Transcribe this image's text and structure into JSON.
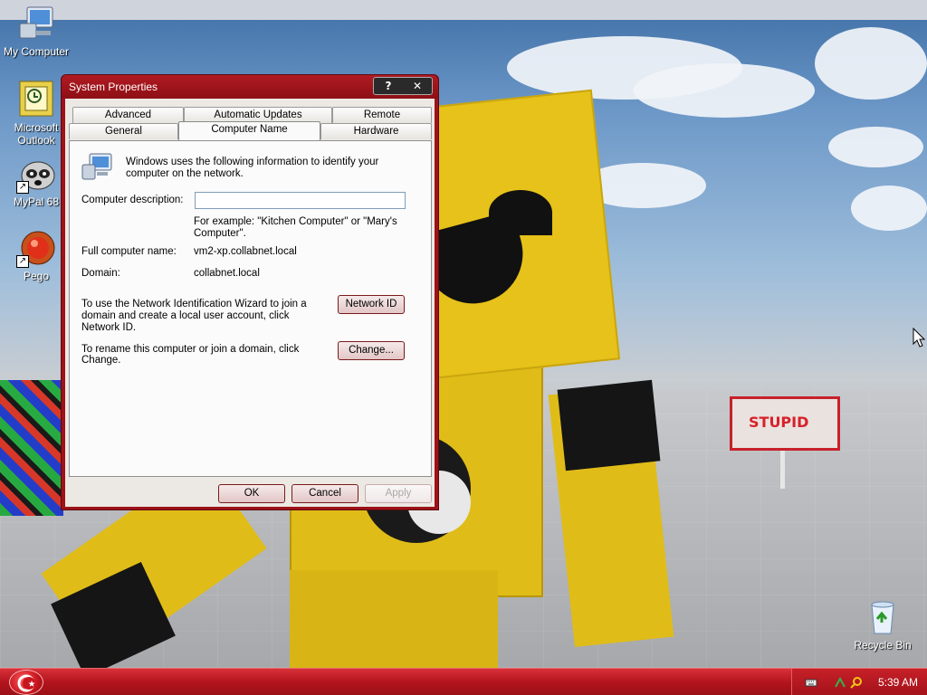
{
  "desktop": {
    "icons": [
      {
        "label": "My Computer"
      },
      {
        "label": "Microsoft Outlook"
      },
      {
        "label": "MyPal 68"
      },
      {
        "label": "Pego"
      },
      {
        "label": "Recycle Bin"
      }
    ],
    "sign_text": "STUPID"
  },
  "dialog": {
    "title": "System Properties",
    "help_button": "?",
    "close_button": "✕",
    "tabs_back": [
      "Advanced",
      "Automatic Updates",
      "Remote"
    ],
    "tabs_front": [
      "General",
      "Computer Name",
      "Hardware"
    ],
    "active_tab": "Computer Name",
    "intro": "Windows uses the following information to identify your computer on the network.",
    "description_label": "Computer description:",
    "description_value": "",
    "example_text": "For example: \"Kitchen Computer\" or \"Mary's Computer\".",
    "full_name_label": "Full computer name:",
    "full_name_value": "vm2-xp.collabnet.local",
    "domain_label": "Domain:",
    "domain_value": "collabnet.local",
    "network_id_text": "To use the Network Identification Wizard to join a domain and create a local user account, click Network ID.",
    "network_id_button": "Network ID",
    "rename_text": "To rename this computer or join a domain, click Change.",
    "change_button": "Change...",
    "ok_button": "OK",
    "cancel_button": "Cancel",
    "apply_button": "Apply"
  },
  "taskbar": {
    "clock": "5:39 AM"
  },
  "colors": {
    "titlebar": "#9e1218",
    "taskbar": "#b4151d",
    "dialog_face": "#ece9e4"
  }
}
